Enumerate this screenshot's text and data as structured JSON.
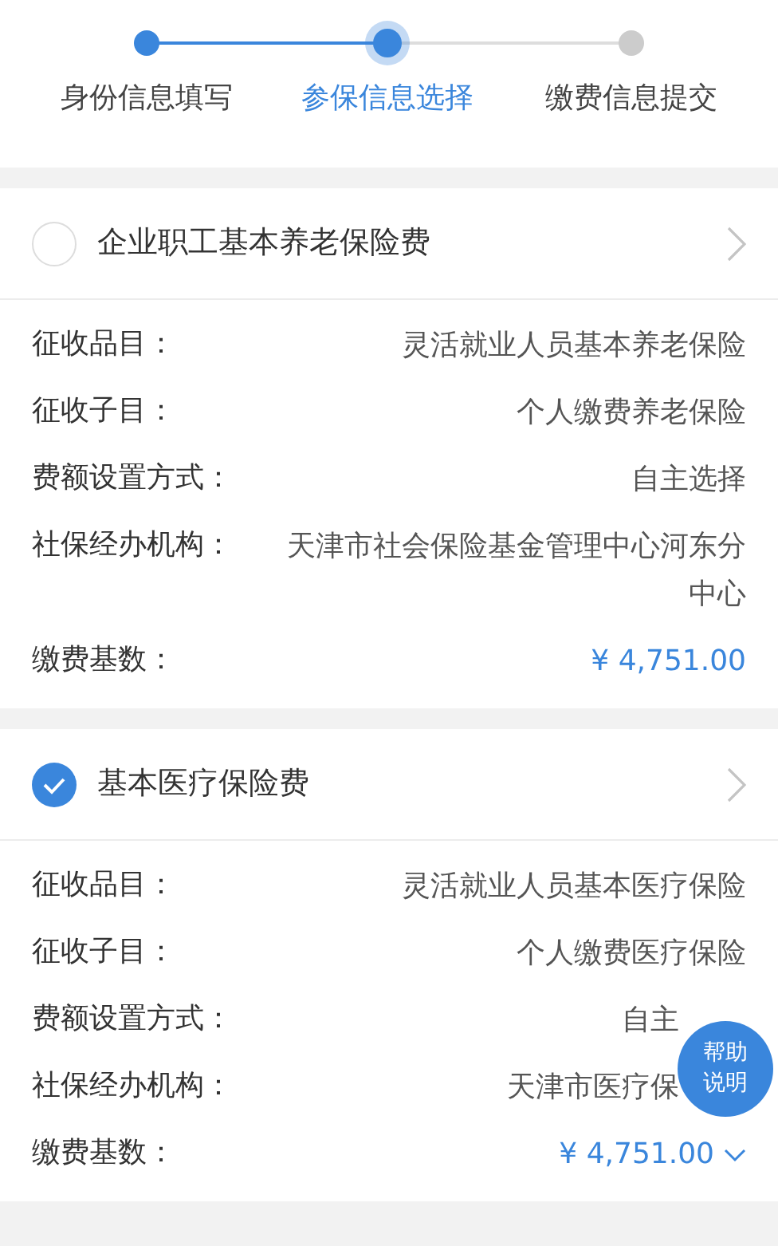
{
  "steps": [
    {
      "label": "身份信息填写",
      "done": true,
      "selected": false
    },
    {
      "label": "参保信息选择",
      "done": true,
      "selected": true
    },
    {
      "label": "缴费信息提交",
      "done": false,
      "selected": false
    }
  ],
  "cards": [
    {
      "title": "企业职工基本养老保险费",
      "selected": false,
      "rows": [
        {
          "label": "征收品目：",
          "value": "灵活就业人员基本养老保险",
          "kind": "text"
        },
        {
          "label": "征收子目：",
          "value": "个人缴费养老保险",
          "kind": "text"
        },
        {
          "label": "费额设置方式：",
          "value": "自主选择",
          "kind": "text"
        },
        {
          "label": "社保经办机构：",
          "value": "天津市社会保险基金管理中心河东分中心",
          "kind": "text"
        },
        {
          "label": "缴费基数：",
          "value": "¥ 4,751.00",
          "kind": "amount"
        }
      ]
    },
    {
      "title": "基本医疗保险费",
      "selected": true,
      "rows": [
        {
          "label": "征收品目：",
          "value": "灵活就业人员基本医疗保险",
          "kind": "text"
        },
        {
          "label": "征收子目：",
          "value": "个人缴费医疗保险",
          "kind": "text"
        },
        {
          "label": "费额设置方式：",
          "value": "自主",
          "kind": "text",
          "covered": true
        },
        {
          "label": "社保经办机构：",
          "value": "天津市医疗保",
          "kind": "text",
          "covered": true
        },
        {
          "label": "缴费基数：",
          "value": "¥ 4,751.00",
          "kind": "amount_dropdown"
        }
      ]
    }
  ],
  "help_button": {
    "lines": [
      "帮助",
      "说明"
    ]
  }
}
